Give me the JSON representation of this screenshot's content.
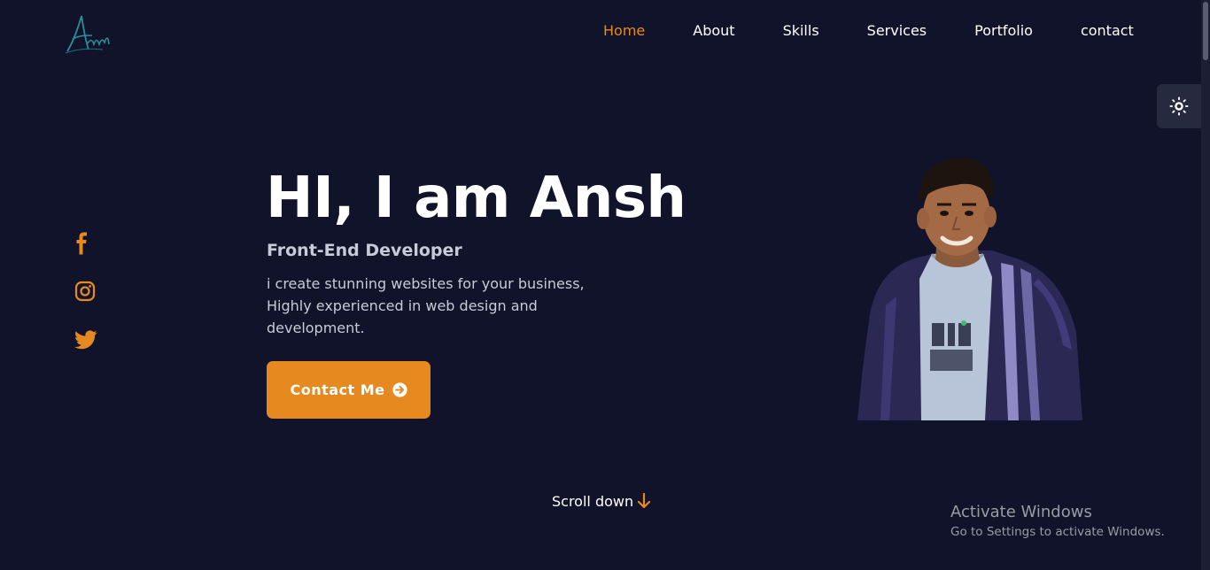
{
  "nav": {
    "items": [
      {
        "label": "Home",
        "active": true
      },
      {
        "label": "About"
      },
      {
        "label": "Skills"
      },
      {
        "label": "Services"
      },
      {
        "label": "Portfolio"
      },
      {
        "label": "contact"
      }
    ]
  },
  "hero": {
    "title": "HI, I am Ansh",
    "subtitle": "Front-End Developer",
    "description": "i create stunning websites for your business, Highly experienced in web design and development.",
    "button_label": "Contact Me"
  },
  "scroll": {
    "label": "Scroll down"
  },
  "social": [
    {
      "icon": "facebook-icon"
    },
    {
      "icon": "instagram-icon"
    },
    {
      "icon": "twitter-icon"
    }
  ],
  "theme_toggle": {
    "icon": "sun-icon"
  },
  "os_overlay": {
    "title": "Activate Windows",
    "subtitle": "Go to Settings to activate Windows."
  },
  "colors": {
    "background": "#11132a",
    "accent": "#e68a20",
    "text": "#ffffff",
    "muted_text": "#c9cad8"
  }
}
